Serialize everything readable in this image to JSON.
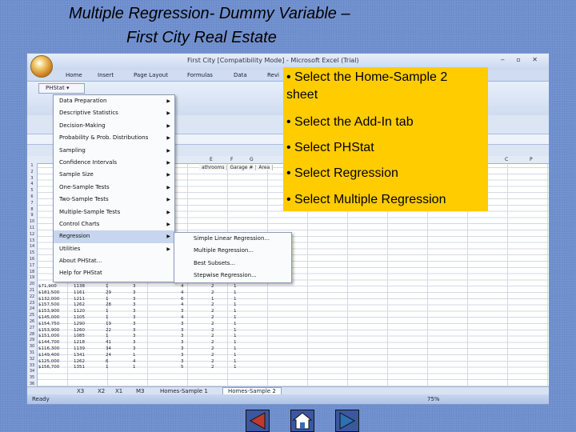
{
  "slide": {
    "title_line1": "Multiple Regression- Dummy Variable  –",
    "title_line2": "First City Real Estate"
  },
  "excel": {
    "window_title": "First City  [Compatibility Mode] - Microsoft Excel (Trial)",
    "ribbon_tabs": [
      "Home",
      "Insert",
      "Page Layout",
      "Formulas",
      "Data",
      "Revi"
    ],
    "phstat_label": "PHStat",
    "column_headers": [
      "E",
      "F",
      "G",
      "C",
      "P"
    ],
    "partial_headers": [
      "athrooms",
      "Garage #",
      "Area"
    ],
    "sheet_tabs": [
      "X3",
      "X2",
      "X1",
      "M3",
      "Homes-Sample 1",
      "Homes-Sample 2"
    ],
    "active_sheet": "Homes-Sample 2",
    "status_left": "Ready",
    "zoom": "75%",
    "data_rows": [
      [
        "$71,900",
        "1138",
        "1",
        "3",
        "4",
        "2",
        "1"
      ],
      [
        "$181,500",
        "1161",
        "29",
        "3",
        "4",
        "2",
        "1"
      ],
      [
        "$132,000",
        "1211",
        "1",
        "3",
        "6",
        "1",
        "1"
      ],
      [
        "$157,500",
        "1262",
        "28",
        "3",
        "4",
        "2",
        "1"
      ],
      [
        "$153,900",
        "1120",
        "1",
        "3",
        "3",
        "2",
        "1"
      ],
      [
        "$145,000",
        "1105",
        "1",
        "3",
        "4",
        "2",
        "1"
      ],
      [
        "$154,750",
        "1290",
        "19",
        "3",
        "3",
        "2",
        "1"
      ],
      [
        "$153,900",
        "1260",
        "22",
        "3",
        "3",
        "2",
        "1"
      ],
      [
        "$151,000",
        "1085",
        "1",
        "3",
        "3",
        "2",
        "1"
      ],
      [
        "$144,700",
        "1218",
        "41",
        "3",
        "3",
        "2",
        "1"
      ],
      [
        "$116,300",
        "1139",
        "34",
        "3",
        "3",
        "2",
        "1"
      ],
      [
        "$149,400",
        "1341",
        "24",
        "1",
        "3",
        "2",
        "1"
      ],
      [
        "$125,000",
        "1262",
        "6",
        "4",
        "3",
        "2",
        "1"
      ],
      [
        "$156,700",
        "1351",
        "1",
        "1",
        "5",
        "2",
        "1"
      ]
    ]
  },
  "phstat_menu": {
    "items": [
      {
        "label": "Data Preparation",
        "arrow": true
      },
      {
        "label": "Descriptive Statistics",
        "arrow": true
      },
      {
        "label": "Decision-Making",
        "arrow": true
      },
      {
        "label": "Probability & Prob. Distributions",
        "arrow": true
      },
      {
        "label": "Sampling",
        "arrow": true
      },
      {
        "label": "Confidence Intervals",
        "arrow": true
      },
      {
        "label": "Sample Size",
        "arrow": true
      },
      {
        "label": "One-Sample Tests",
        "arrow": true
      },
      {
        "label": "Two-Sample Tests",
        "arrow": true
      },
      {
        "label": "Multiple-Sample Tests",
        "arrow": true
      },
      {
        "label": "Control Charts",
        "arrow": true
      },
      {
        "label": "Regression",
        "arrow": true
      },
      {
        "label": "Utilities",
        "arrow": true
      },
      {
        "label": "About PHStat...",
        "arrow": false
      },
      {
        "label": "Help for PHStat",
        "arrow": false
      }
    ],
    "highlighted": "Regression"
  },
  "regression_submenu": {
    "items": [
      "Simple Linear Regression...",
      "Multiple Regression...",
      "Best Subsets...",
      "Stepwise Regression..."
    ]
  },
  "callout": {
    "bullets": [
      "• Select the Home-Sample 2",
      "sheet",
      "• Select the Add-In tab",
      "• Select PHStat",
      "• Select Regression",
      "• Select Multiple Regression"
    ]
  },
  "nav": {
    "prev_icon": "back-arrow-icon",
    "home_icon": "home-icon",
    "next_icon": "forward-arrow-icon",
    "colors": {
      "arrow_fill": "#c0392b",
      "home_fill": "#2f6fb5",
      "button_bg": "#3b57a0"
    }
  }
}
